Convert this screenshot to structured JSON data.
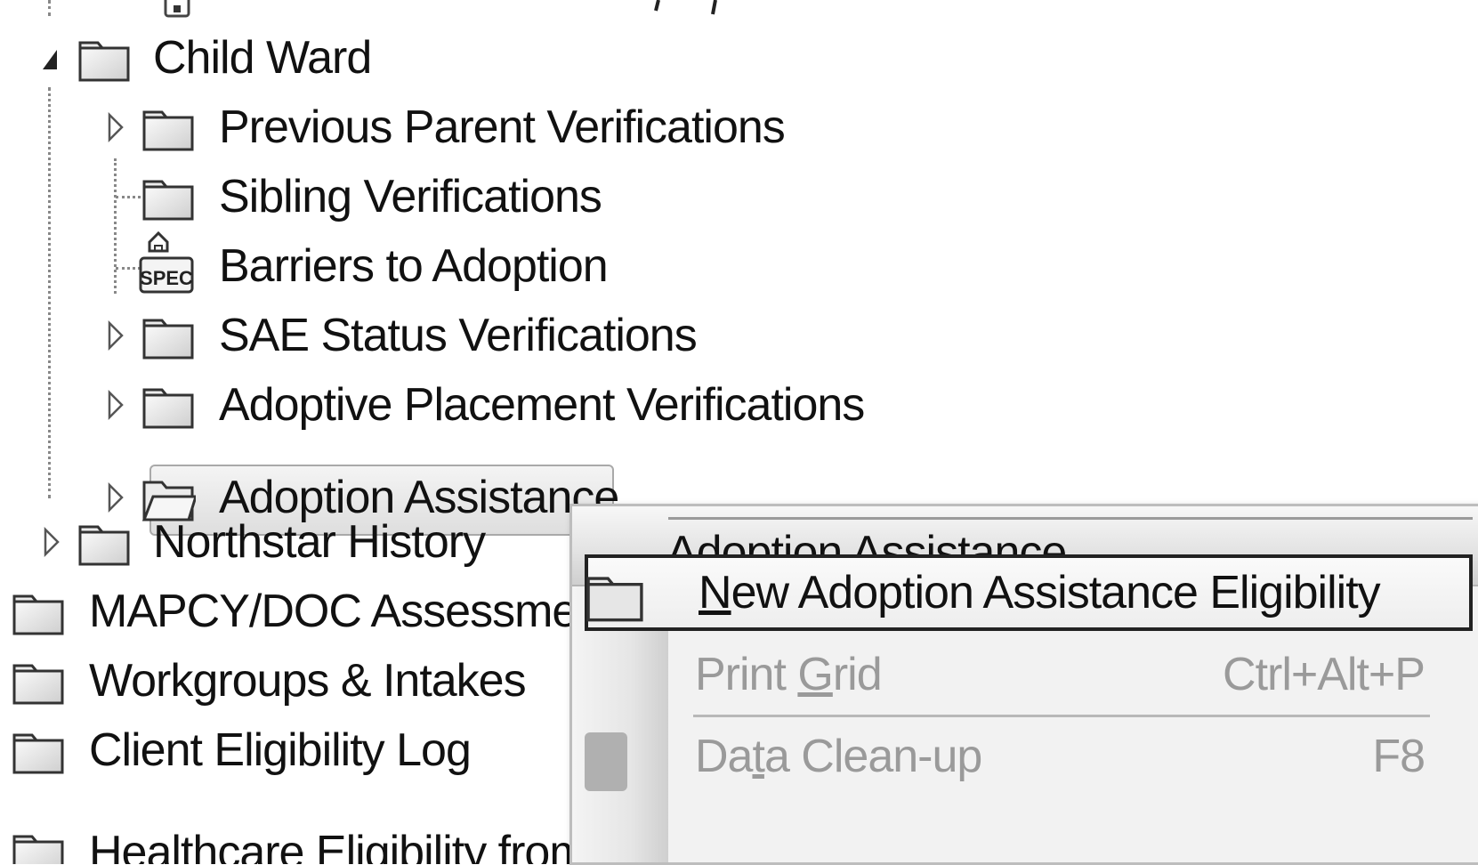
{
  "tree": {
    "child_ward": "Child Ward",
    "previous_parent_verifications": "Previous Parent Verifications",
    "sibling_verifications": "Sibling Verifications",
    "barriers_to_adoption": "Barriers to Adoption",
    "barriers_icon_text": "SPEC",
    "sae_status_verifications": "SAE Status Verifications",
    "adoptive_placement_verifications": "Adoptive Placement Verifications",
    "adoption_assistance": "Adoption Assistance",
    "northstar_history": "Northstar History",
    "mapcy_doc_assessments": "MAPCY/DOC Assessments",
    "workgroups_intakes": "Workgroups & Intakes",
    "client_eligibility_log": "Client Eligibility Log",
    "healthcare_eligibility": "Healthcare Eligibility from MMIS"
  },
  "context_menu": {
    "title": "Adoption Assistance",
    "items": [
      {
        "label_prefix": "",
        "mnemonic": "N",
        "label_suffix": "ew Adoption Assistance Eligibility",
        "shortcut": "",
        "enabled": true
      },
      {
        "label_prefix": "Print ",
        "mnemonic": "G",
        "label_suffix": "rid",
        "shortcut": "Ctrl+Alt+P",
        "enabled": false
      },
      {
        "label_prefix": "Da",
        "mnemonic": "t",
        "label_suffix": "a Clean-up",
        "shortcut": "F8",
        "enabled": false
      }
    ]
  },
  "colors": {
    "text": "#111111",
    "disabled_text": "#9a9a9a",
    "selection_border": "#a9a9a9",
    "menu_highlight_border": "#222222"
  }
}
